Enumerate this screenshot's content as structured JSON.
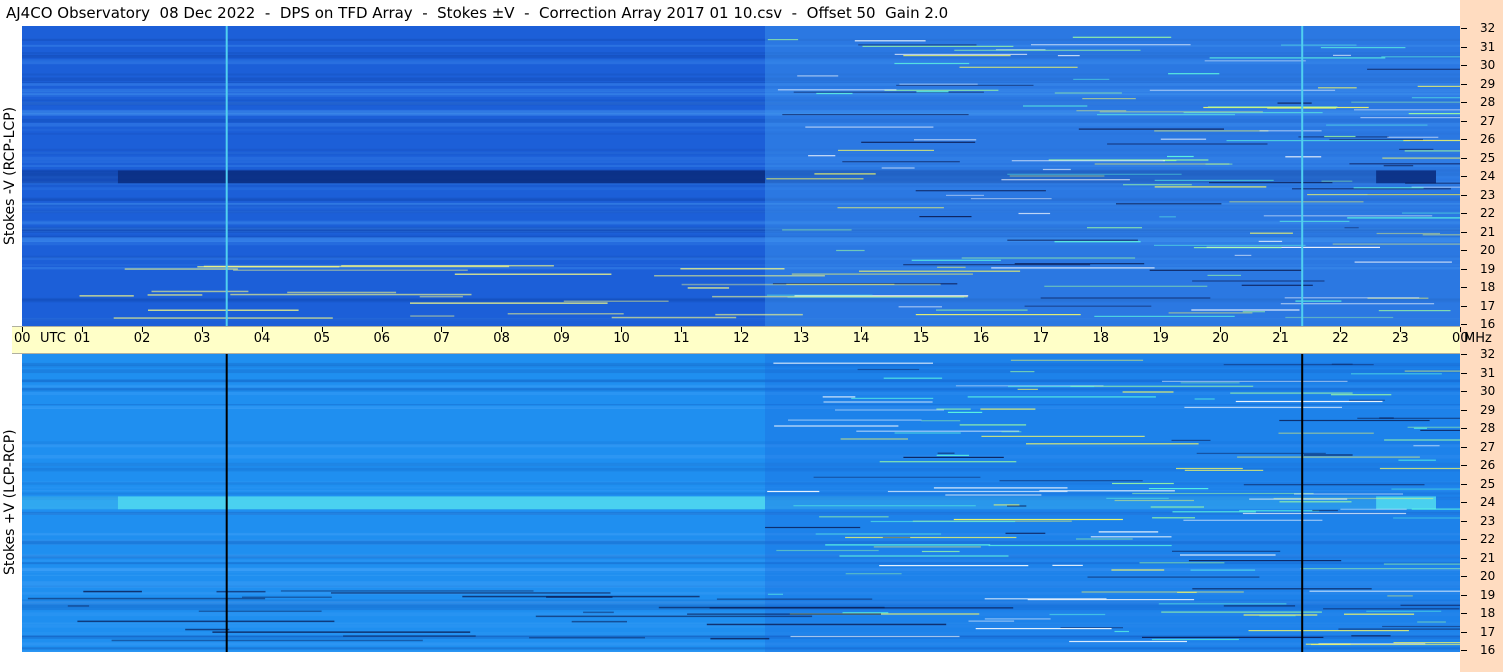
{
  "title": "AJ4CO Observatory  08 Dec 2022  -  DPS on TFD Array  -  Stokes ±V  -  Correction Array 2017 01 10.csv  -  Offset 50  Gain 2.0",
  "panels": {
    "top_label": "Stokes -V (RCP-LCP)",
    "bottom_label": "Stokes +V (LCP-RCP)"
  },
  "colors": {
    "top_base": "#1c5fd8",
    "bottom_base": "#1f8ff0",
    "dark_band": "#0a2c80",
    "bright_band": "#4fd8f0",
    "right_strip": "#ffdcc0",
    "time_bar": "#ffffc8"
  },
  "chart_data": {
    "type": "heatmap",
    "title": "AJ4CO Observatory  08 Dec 2022  -  DPS on TFD Array  -  Stokes ±V  -  Correction Array 2017 01 10.csv  -  Offset 50  Gain 2.0",
    "x_axis": {
      "ticks": [
        "00",
        "UTC",
        "01",
        "02",
        "03",
        "04",
        "05",
        "06",
        "07",
        "08",
        "09",
        "10",
        "11",
        "12",
        "13",
        "14",
        "15",
        "16",
        "17",
        "18",
        "19",
        "20",
        "21",
        "22",
        "23",
        "00",
        "MHz"
      ],
      "range_hours": [
        0,
        24
      ]
    },
    "y_axis": {
      "unit": "MHz",
      "ticks": [
        "32",
        "31",
        "30",
        "29",
        "28",
        "27",
        "26",
        "25",
        "24",
        "23",
        "22",
        "21",
        "20",
        "19",
        "18",
        "17",
        "16"
      ],
      "range_mhz": [
        16,
        32
      ]
    },
    "panels": [
      {
        "name": "Stokes -V (RCP-LCP)",
        "band_24mhz": "dark"
      },
      {
        "name": "Stokes +V (LCP-RCP)",
        "band_24mhz": "bright"
      }
    ],
    "vertical_markers_utc": [
      3.4,
      21.35
    ]
  }
}
